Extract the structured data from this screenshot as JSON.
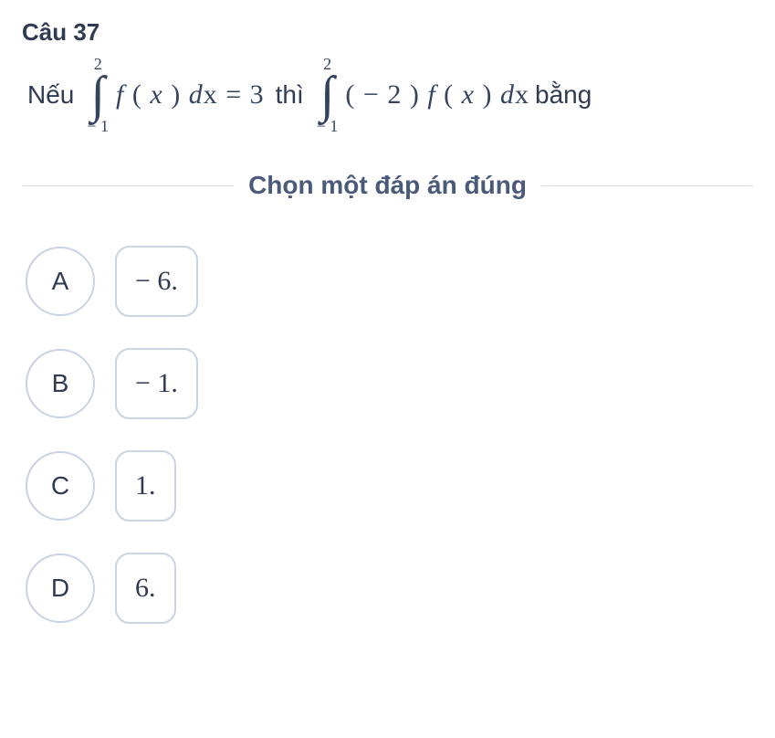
{
  "question_label": "Câu 37",
  "prompt": {
    "neu": "Nếu",
    "int1_upper": "2",
    "int1_lower": "− 1",
    "expr1": "f ( x ) d x = 3",
    "thi": "thì",
    "int2_upper": "2",
    "int2_lower": "− 1",
    "expr2": "( − 2 ) f ( x ) d x",
    "bang": "bằng"
  },
  "instruction": "Chọn một đáp án đúng",
  "choices": [
    {
      "letter": "A",
      "value": "− 6."
    },
    {
      "letter": "B",
      "value": "− 1."
    },
    {
      "letter": "C",
      "value": "1."
    },
    {
      "letter": "D",
      "value": "6."
    }
  ]
}
